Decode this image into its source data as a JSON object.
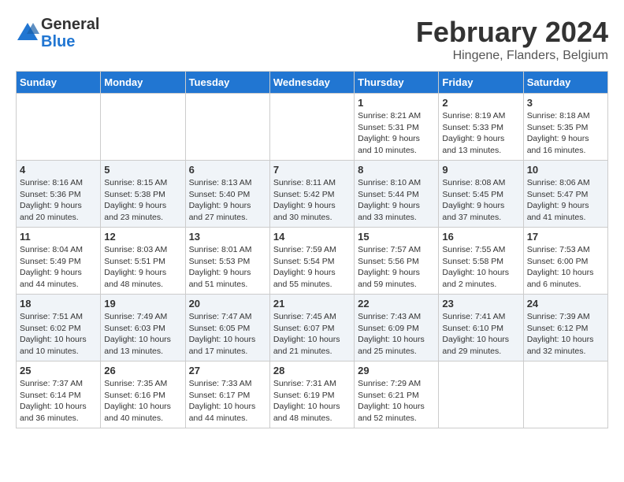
{
  "header": {
    "logo_general": "General",
    "logo_blue": "Blue",
    "month_title": "February 2024",
    "location": "Hingene, Flanders, Belgium"
  },
  "days_of_week": [
    "Sunday",
    "Monday",
    "Tuesday",
    "Wednesday",
    "Thursday",
    "Friday",
    "Saturday"
  ],
  "weeks": [
    [
      {
        "day": "",
        "detail": ""
      },
      {
        "day": "",
        "detail": ""
      },
      {
        "day": "",
        "detail": ""
      },
      {
        "day": "",
        "detail": ""
      },
      {
        "day": "1",
        "detail": "Sunrise: 8:21 AM\nSunset: 5:31 PM\nDaylight: 9 hours\nand 10 minutes."
      },
      {
        "day": "2",
        "detail": "Sunrise: 8:19 AM\nSunset: 5:33 PM\nDaylight: 9 hours\nand 13 minutes."
      },
      {
        "day": "3",
        "detail": "Sunrise: 8:18 AM\nSunset: 5:35 PM\nDaylight: 9 hours\nand 16 minutes."
      }
    ],
    [
      {
        "day": "4",
        "detail": "Sunrise: 8:16 AM\nSunset: 5:36 PM\nDaylight: 9 hours\nand 20 minutes."
      },
      {
        "day": "5",
        "detail": "Sunrise: 8:15 AM\nSunset: 5:38 PM\nDaylight: 9 hours\nand 23 minutes."
      },
      {
        "day": "6",
        "detail": "Sunrise: 8:13 AM\nSunset: 5:40 PM\nDaylight: 9 hours\nand 27 minutes."
      },
      {
        "day": "7",
        "detail": "Sunrise: 8:11 AM\nSunset: 5:42 PM\nDaylight: 9 hours\nand 30 minutes."
      },
      {
        "day": "8",
        "detail": "Sunrise: 8:10 AM\nSunset: 5:44 PM\nDaylight: 9 hours\nand 33 minutes."
      },
      {
        "day": "9",
        "detail": "Sunrise: 8:08 AM\nSunset: 5:45 PM\nDaylight: 9 hours\nand 37 minutes."
      },
      {
        "day": "10",
        "detail": "Sunrise: 8:06 AM\nSunset: 5:47 PM\nDaylight: 9 hours\nand 41 minutes."
      }
    ],
    [
      {
        "day": "11",
        "detail": "Sunrise: 8:04 AM\nSunset: 5:49 PM\nDaylight: 9 hours\nand 44 minutes."
      },
      {
        "day": "12",
        "detail": "Sunrise: 8:03 AM\nSunset: 5:51 PM\nDaylight: 9 hours\nand 48 minutes."
      },
      {
        "day": "13",
        "detail": "Sunrise: 8:01 AM\nSunset: 5:53 PM\nDaylight: 9 hours\nand 51 minutes."
      },
      {
        "day": "14",
        "detail": "Sunrise: 7:59 AM\nSunset: 5:54 PM\nDaylight: 9 hours\nand 55 minutes."
      },
      {
        "day": "15",
        "detail": "Sunrise: 7:57 AM\nSunset: 5:56 PM\nDaylight: 9 hours\nand 59 minutes."
      },
      {
        "day": "16",
        "detail": "Sunrise: 7:55 AM\nSunset: 5:58 PM\nDaylight: 10 hours\nand 2 minutes."
      },
      {
        "day": "17",
        "detail": "Sunrise: 7:53 AM\nSunset: 6:00 PM\nDaylight: 10 hours\nand 6 minutes."
      }
    ],
    [
      {
        "day": "18",
        "detail": "Sunrise: 7:51 AM\nSunset: 6:02 PM\nDaylight: 10 hours\nand 10 minutes."
      },
      {
        "day": "19",
        "detail": "Sunrise: 7:49 AM\nSunset: 6:03 PM\nDaylight: 10 hours\nand 13 minutes."
      },
      {
        "day": "20",
        "detail": "Sunrise: 7:47 AM\nSunset: 6:05 PM\nDaylight: 10 hours\nand 17 minutes."
      },
      {
        "day": "21",
        "detail": "Sunrise: 7:45 AM\nSunset: 6:07 PM\nDaylight: 10 hours\nand 21 minutes."
      },
      {
        "day": "22",
        "detail": "Sunrise: 7:43 AM\nSunset: 6:09 PM\nDaylight: 10 hours\nand 25 minutes."
      },
      {
        "day": "23",
        "detail": "Sunrise: 7:41 AM\nSunset: 6:10 PM\nDaylight: 10 hours\nand 29 minutes."
      },
      {
        "day": "24",
        "detail": "Sunrise: 7:39 AM\nSunset: 6:12 PM\nDaylight: 10 hours\nand 32 minutes."
      }
    ],
    [
      {
        "day": "25",
        "detail": "Sunrise: 7:37 AM\nSunset: 6:14 PM\nDaylight: 10 hours\nand 36 minutes."
      },
      {
        "day": "26",
        "detail": "Sunrise: 7:35 AM\nSunset: 6:16 PM\nDaylight: 10 hours\nand 40 minutes."
      },
      {
        "day": "27",
        "detail": "Sunrise: 7:33 AM\nSunset: 6:17 PM\nDaylight: 10 hours\nand 44 minutes."
      },
      {
        "day": "28",
        "detail": "Sunrise: 7:31 AM\nSunset: 6:19 PM\nDaylight: 10 hours\nand 48 minutes."
      },
      {
        "day": "29",
        "detail": "Sunrise: 7:29 AM\nSunset: 6:21 PM\nDaylight: 10 hours\nand 52 minutes."
      },
      {
        "day": "",
        "detail": ""
      },
      {
        "day": "",
        "detail": ""
      }
    ]
  ]
}
